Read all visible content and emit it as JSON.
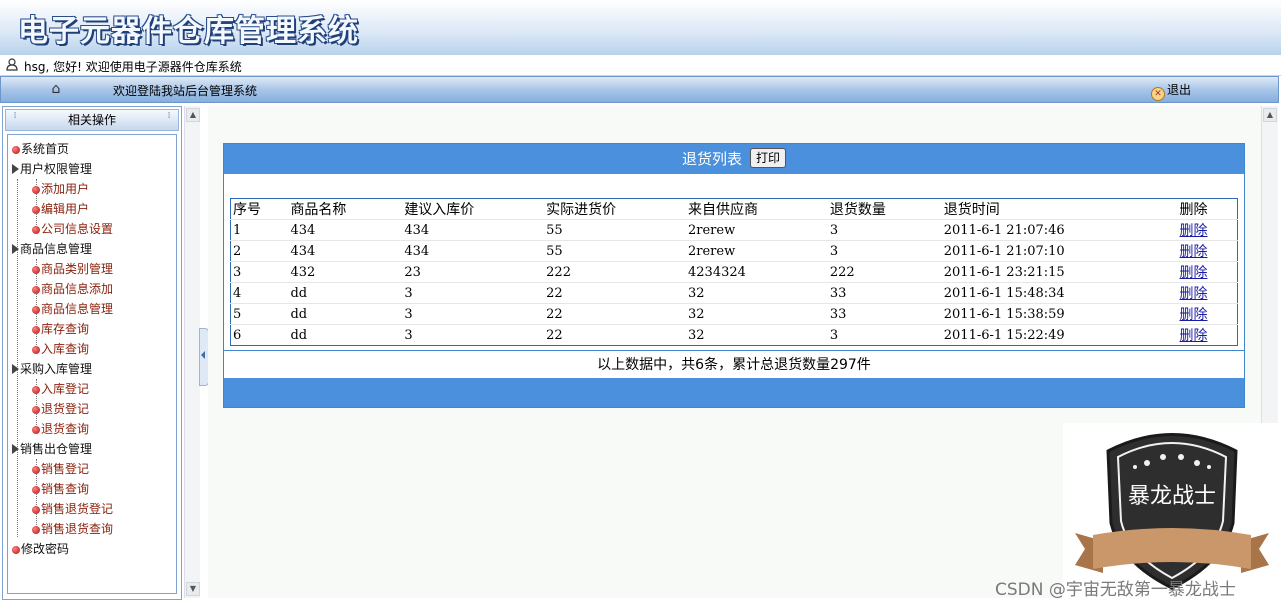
{
  "app": {
    "title": "电子元器件仓库管理系统"
  },
  "user_bar": {
    "greeting": "hsg, 您好! 欢迎使用电子源器件仓库系统"
  },
  "nav": {
    "welcome": "欢迎登陆我站后台管理系统",
    "exit_label": "退出"
  },
  "sidebar": {
    "header": "相关操作",
    "items": [
      {
        "label": "系统首页",
        "level": 0,
        "kind": "leaf"
      },
      {
        "label": "用户权限管理",
        "level": 0,
        "kind": "group"
      },
      {
        "label": "添加用户",
        "level": 1,
        "kind": "leaf"
      },
      {
        "label": "编辑用户",
        "level": 1,
        "kind": "leaf"
      },
      {
        "label": "公司信息设置",
        "level": 1,
        "kind": "leaf"
      },
      {
        "label": "商品信息管理",
        "level": 0,
        "kind": "group"
      },
      {
        "label": "商品类别管理",
        "level": 1,
        "kind": "leaf"
      },
      {
        "label": "商品信息添加",
        "level": 1,
        "kind": "leaf"
      },
      {
        "label": "商品信息管理",
        "level": 1,
        "kind": "leaf"
      },
      {
        "label": "库存查询",
        "level": 1,
        "kind": "leaf"
      },
      {
        "label": "入库查询",
        "level": 1,
        "kind": "leaf"
      },
      {
        "label": "采购入库管理",
        "level": 0,
        "kind": "group"
      },
      {
        "label": "入库登记",
        "level": 1,
        "kind": "leaf"
      },
      {
        "label": "退货登记",
        "level": 1,
        "kind": "leaf"
      },
      {
        "label": "退货查询",
        "level": 1,
        "kind": "leaf"
      },
      {
        "label": "销售出仓管理",
        "level": 0,
        "kind": "group"
      },
      {
        "label": "销售登记",
        "level": 1,
        "kind": "leaf"
      },
      {
        "label": "销售查询",
        "level": 1,
        "kind": "leaf"
      },
      {
        "label": "销售退货登记",
        "level": 1,
        "kind": "leaf"
      },
      {
        "label": "销售退货查询",
        "level": 1,
        "kind": "leaf"
      },
      {
        "label": "修改密码",
        "level": 0,
        "kind": "leaf"
      }
    ]
  },
  "panel": {
    "title": "退货列表",
    "print_label": "打印",
    "columns": [
      "序号",
      "商品名称",
      "建议入库价",
      "实际进货价",
      "来自供应商",
      "退货数量",
      "退货时间",
      "删除"
    ],
    "rows": [
      [
        "1",
        "434",
        "434",
        "55",
        "2rerew",
        "3",
        "2011-6-1  21:07:46",
        "删除"
      ],
      [
        "2",
        "434",
        "434",
        "55",
        "2rerew",
        "3",
        "2011-6-1  21:07:10",
        "删除"
      ],
      [
        "3",
        "432",
        "23",
        "222",
        "4234324",
        "222",
        "2011-6-1  23:21:15",
        "删除"
      ],
      [
        "4",
        "dd",
        "3",
        "22",
        "32",
        "33",
        "2011-6-1  15:48:34",
        "删除"
      ],
      [
        "5",
        "dd",
        "3",
        "22",
        "32",
        "33",
        "2011-6-1  15:38:59",
        "删除"
      ],
      [
        "6",
        "dd",
        "3",
        "22",
        "32",
        "3",
        "2011-6-1  15:22:49",
        "删除"
      ]
    ],
    "summary": "以上数据中，共6条，累计总退货数量297件"
  },
  "watermark": {
    "badge_text": "暴龙战士",
    "caption": "CSDN @宇宙无敌第一暴龙战士"
  },
  "colors": {
    "accent_blue": "#4a90dc",
    "tree_link": "#8a1f0b",
    "delete_link": "#1a1aa6"
  }
}
